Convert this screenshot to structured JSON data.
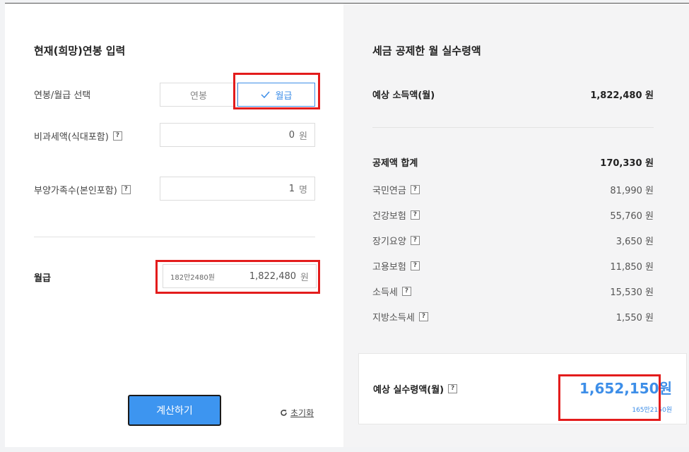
{
  "input": {
    "title": "현재(희망)연봉 입력",
    "mode_label": "연봉/월급 선택",
    "mode_options": [
      "연봉",
      "월급"
    ],
    "mode_selected": "월급",
    "nontax_label": "비과세액(식대포함)",
    "nontax_value": "0",
    "nontax_unit": "원",
    "dependents_label": "부양가족수(본인포함)",
    "dependents_value": "1",
    "dependents_unit": "명",
    "salary_label": "월급",
    "salary_hint": "182만2480원",
    "salary_value": "1,822,480",
    "salary_unit": "원",
    "calc_button": "계산하기",
    "reset_label": "초기화"
  },
  "result": {
    "title": "세금 공제한 월 실수령액",
    "income_label": "예상 소득액(월)",
    "income_value": "1,822,480 원",
    "deduction_total_label": "공제액 합계",
    "deduction_total_value": "170,330 원",
    "deductions": [
      {
        "label": "국민연금",
        "value": "81,990 원"
      },
      {
        "label": "건강보험",
        "value": "55,760 원"
      },
      {
        "label": "장기요양",
        "value": "3,650 원"
      },
      {
        "label": "고용보험",
        "value": "11,850 원"
      },
      {
        "label": "소득세",
        "value": "15,530 원"
      },
      {
        "label": "지방소득세",
        "value": "1,550 원"
      }
    ],
    "net_label": "예상 실수령액(월)",
    "net_value": "1,652,150원",
    "net_sub": "165만2150원"
  },
  "icons": {
    "help": "?",
    "check": "check-icon",
    "reset": "refresh-icon"
  },
  "colors": {
    "accent": "#3d8ee8",
    "highlight": "#e31c1c",
    "button": "#3d95f0"
  }
}
